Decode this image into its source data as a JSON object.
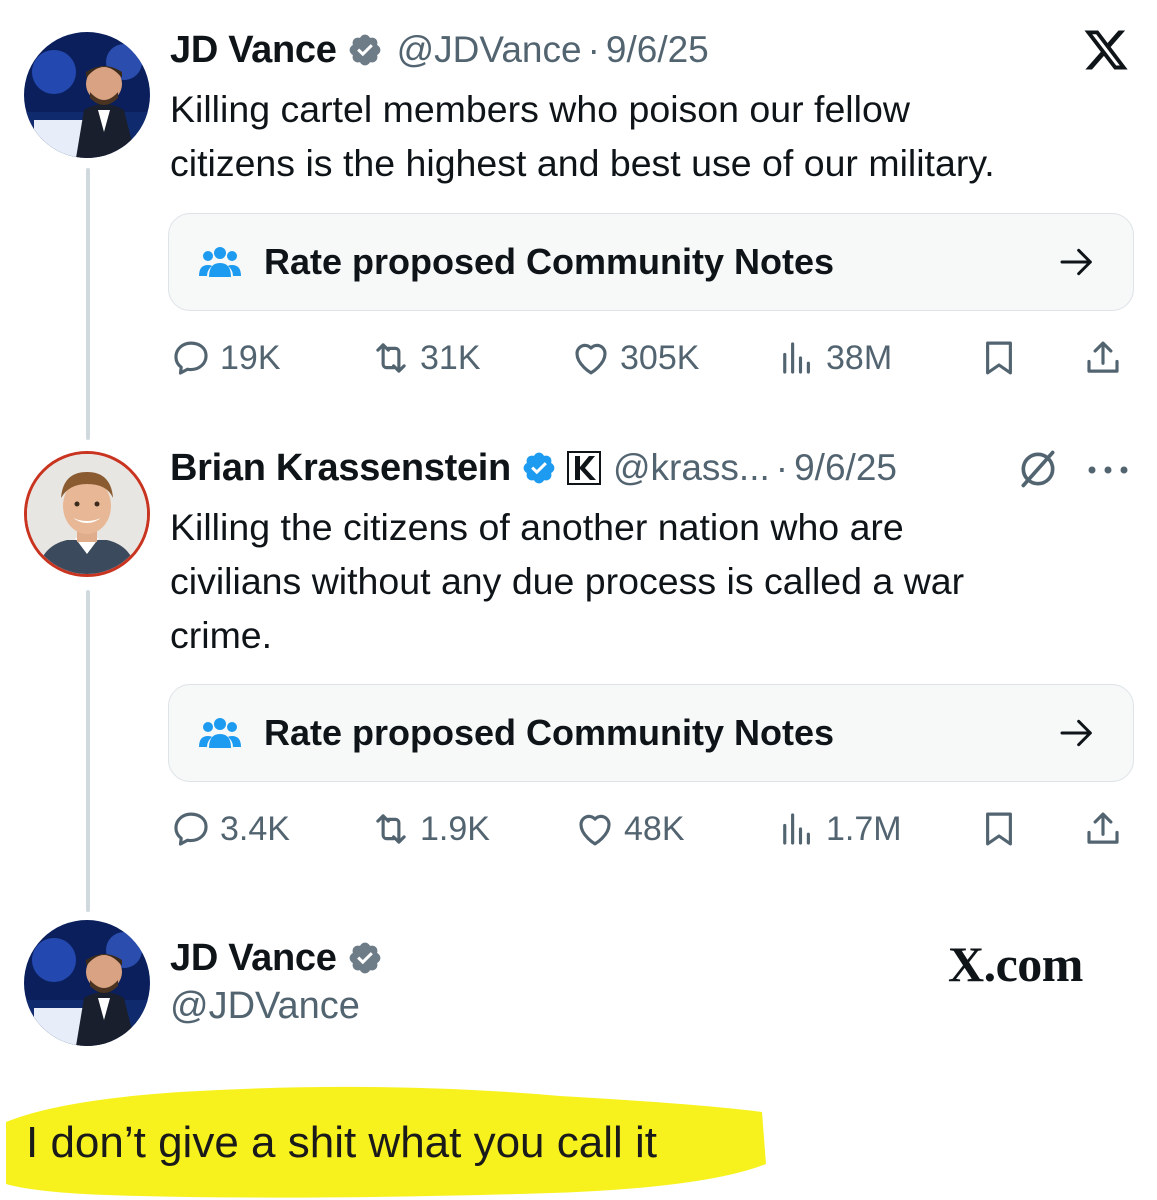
{
  "tweet1": {
    "name": "JD Vance",
    "handle": "@JDVance",
    "dot": "·",
    "date": "9/6/25",
    "text_line1": "Killing cartel members who poison our fellow",
    "text_line2": "citizens is the highest and best use of our military.",
    "note_label": "Rate proposed Community Notes",
    "replies": "19K",
    "reposts": "31K",
    "likes": "305K",
    "views": "38M"
  },
  "tweet2": {
    "name": "Brian Krassenstein",
    "handle": "@krass...",
    "dot": "·",
    "date": "9/6/25",
    "text_line1": "Killing the citizens of another nation who are",
    "text_line2": "civilians without any due process is called a war",
    "text_line3": "crime.",
    "note_label": "Rate proposed Community Notes",
    "replies": "3.4K",
    "reposts": "1.9K",
    "likes": "48K",
    "views": "1.7M"
  },
  "reply_card": {
    "name": "JD Vance",
    "handle": "@JDVance",
    "brand": "X.com"
  },
  "caption": {
    "text": "I don’t give a shit what you call it",
    "highlight_color": "#f7f21e"
  },
  "icons": {
    "verified": "verified-badge-icon",
    "community_notes": "community-notes-icon",
    "arrow": "arrow-right-icon",
    "reply": "reply-icon",
    "repost": "repost-icon",
    "like": "heart-icon",
    "views": "views-icon",
    "bookmark": "bookmark-icon",
    "share": "share-icon",
    "x_logo": "x-logo-icon"
  },
  "colors": {
    "text": "#0f1419",
    "secondary": "#536471",
    "verified_blue": "#1d9bf0",
    "verified_gray": "#6e7c88",
    "notes_blue": "#1d9bf0"
  }
}
